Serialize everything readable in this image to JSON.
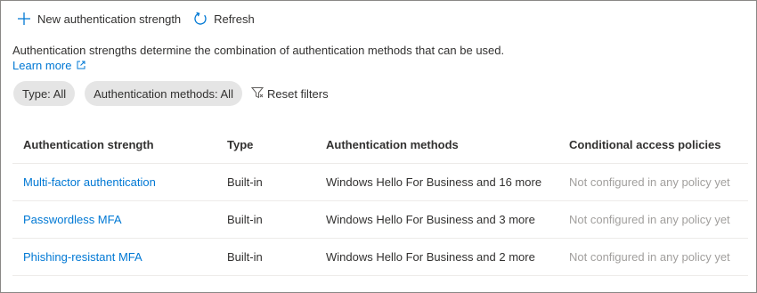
{
  "toolbar": {
    "new_label": "New authentication strength",
    "refresh_label": "Refresh"
  },
  "description": {
    "text": "Authentication strengths determine the combination of authentication methods that can be used.",
    "learn_more": "Learn more"
  },
  "filters": {
    "type": "Type: All",
    "methods": "Authentication methods: All",
    "reset": "Reset filters"
  },
  "table": {
    "headers": [
      "Authentication strength",
      "Type",
      "Authentication methods",
      "Conditional access policies"
    ],
    "rows": [
      {
        "name": "Multi-factor authentication",
        "type": "Built-in",
        "methods": "Windows Hello For Business and 16 more",
        "policies": "Not configured in any policy yet"
      },
      {
        "name": "Passwordless MFA",
        "type": "Built-in",
        "methods": "Windows Hello For Business and 3 more",
        "policies": "Not configured in any policy yet"
      },
      {
        "name": "Phishing-resistant MFA",
        "type": "Built-in",
        "methods": "Windows Hello For Business and 2 more",
        "policies": "Not configured in any policy yet"
      }
    ]
  },
  "colors": {
    "accent": "#0078d4",
    "text": "#323130",
    "muted": "#a19f9d",
    "pill_bg": "#e5e5e5"
  }
}
